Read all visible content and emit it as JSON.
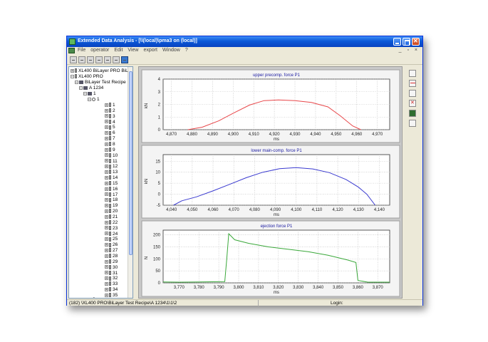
{
  "window": {
    "title": "Extended Data Analysis - [\\\\(local)\\pma3 on (local)]"
  },
  "menubar": {
    "items": [
      "File",
      "operator",
      "Edit",
      "View",
      "export",
      "Window",
      "?"
    ],
    "mdi_controls": "_ ▫ ×"
  },
  "tree": {
    "roots": [
      {
        "label": "XL400 BiLayer PRO BiL",
        "expander": "+"
      },
      {
        "label": "XL400 PRO",
        "expander": "−"
      },
      {
        "label": "BiLayer Test Recipe",
        "expander": "−"
      },
      {
        "label": "A 1234",
        "expander": "−"
      },
      {
        "label": "1",
        "expander": "−"
      },
      {
        "label": "1",
        "expander": "−"
      }
    ],
    "items": [
      "1",
      "2",
      "3",
      "4",
      "5",
      "6",
      "7",
      "8",
      "9",
      "10",
      "11",
      "12",
      "13",
      "14",
      "15",
      "16",
      "17",
      "18",
      "19",
      "20",
      "21",
      "22",
      "23",
      "24",
      "25",
      "26",
      "27",
      "28",
      "29",
      "30",
      "31",
      "32",
      "33",
      "34",
      "35"
    ],
    "tail": "2"
  },
  "plots": [
    {
      "title": "upper precomp. force P1",
      "ylabel": "kN",
      "xlabel": "ms",
      "color": "#e8474a",
      "xlim": [
        4866,
        4976
      ],
      "ylim": [
        0,
        4
      ],
      "xticks": [
        4870,
        4880,
        4890,
        4900,
        4910,
        4920,
        4930,
        4940,
        4950,
        4960,
        4970
      ],
      "yticks": [
        0,
        1,
        2,
        3,
        4
      ],
      "points": [
        [
          4878,
          0
        ],
        [
          4885,
          0.2
        ],
        [
          4893,
          0.7
        ],
        [
          4900,
          1.3
        ],
        [
          4908,
          1.95
        ],
        [
          4915,
          2.3
        ],
        [
          4922,
          2.35
        ],
        [
          4930,
          2.3
        ],
        [
          4938,
          2.15
        ],
        [
          4946,
          1.8
        ],
        [
          4952,
          1.1
        ],
        [
          4958,
          0.3
        ],
        [
          4962,
          0
        ]
      ]
    },
    {
      "title": "lower main-comp. force P1",
      "ylabel": "kN",
      "xlabel": "ms",
      "color": "#3a3ad0",
      "xlim": [
        4036,
        4145
      ],
      "ylim": [
        -5,
        18
      ],
      "xticks": [
        4040,
        4050,
        4060,
        4070,
        4080,
        4090,
        4100,
        4110,
        4120,
        4130,
        4140
      ],
      "yticks": [
        -5,
        0,
        5,
        10,
        15
      ],
      "points": [
        [
          4041,
          -5
        ],
        [
          4045,
          -3
        ],
        [
          4052,
          -1.2
        ],
        [
          4060,
          1.5
        ],
        [
          4068,
          4.5
        ],
        [
          4076,
          7.5
        ],
        [
          4084,
          10
        ],
        [
          4092,
          11.6
        ],
        [
          4100,
          12.1
        ],
        [
          4108,
          11.5
        ],
        [
          4116,
          9.8
        ],
        [
          4124,
          6.7
        ],
        [
          4130,
          3.2
        ],
        [
          4134,
          0
        ],
        [
          4138,
          -5
        ]
      ]
    },
    {
      "title": "ejection force P1",
      "ylabel": "N",
      "xlabel": "ms",
      "color": "#3aa83a",
      "xlim": [
        3762,
        3876
      ],
      "ylim": [
        0,
        220
      ],
      "xticks": [
        3770,
        3780,
        3790,
        3800,
        3810,
        3820,
        3830,
        3840,
        3850,
        3860,
        3870
      ],
      "yticks": [
        0,
        50,
        100,
        150,
        200
      ],
      "points": [
        [
          3762,
          4
        ],
        [
          3770,
          3
        ],
        [
          3780,
          4
        ],
        [
          3793,
          5
        ],
        [
          3794,
          100
        ],
        [
          3795,
          205
        ],
        [
          3798,
          180
        ],
        [
          3805,
          165
        ],
        [
          3815,
          150
        ],
        [
          3825,
          140
        ],
        [
          3835,
          130
        ],
        [
          3845,
          115
        ],
        [
          3855,
          95
        ],
        [
          3859,
          85
        ],
        [
          3860,
          10
        ],
        [
          3865,
          3
        ],
        [
          3876,
          3
        ]
      ]
    }
  ],
  "statusbar": {
    "path": "(182) \\XL400 PRO\\BiLayer Test Recipe\\A 1234\\1\\1\\2",
    "login": "Login:"
  }
}
